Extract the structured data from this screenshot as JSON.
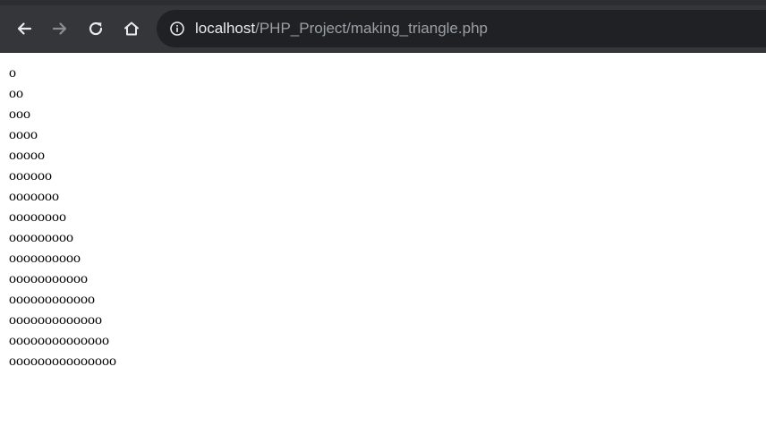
{
  "browser": {
    "url_host": "localhost",
    "url_path": "/PHP_Project/making_triangle.php",
    "icons": {
      "back": "arrow-left-icon",
      "forward": "arrow-right-icon",
      "reload": "reload-icon",
      "home": "home-icon",
      "site_info": "info-icon"
    },
    "colors": {
      "toolbar": "#35363a",
      "omnibox": "#202124",
      "icon_active": "#e8eaed",
      "icon_disabled": "#8a8d91"
    }
  },
  "page": {
    "rows": [
      "o",
      "oo",
      "ooo",
      "oooo",
      "ooooo",
      "oooooo",
      "ooooooo",
      "oooooooo",
      "ooooooooo",
      "oooooooooo",
      "ooooooooooo",
      "oooooooooooo",
      "ooooooooooooo",
      "oooooooooooooo",
      "ooooooooooooooo"
    ]
  }
}
